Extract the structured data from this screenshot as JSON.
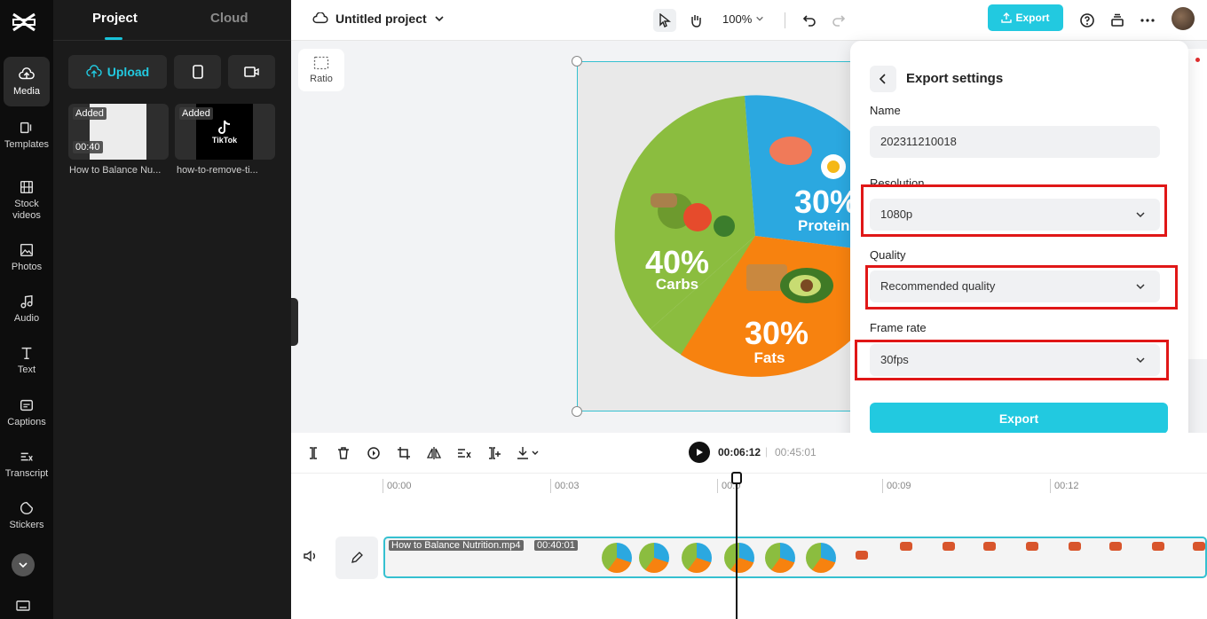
{
  "rail": {
    "items": [
      {
        "label": "Media"
      },
      {
        "label": "Templates"
      },
      {
        "label": "Stock videos"
      },
      {
        "label": "Photos"
      },
      {
        "label": "Audio"
      },
      {
        "label": "Text"
      },
      {
        "label": "Captions"
      },
      {
        "label": "Transcript"
      },
      {
        "label": "Stickers"
      }
    ]
  },
  "panel": {
    "tabs": [
      "Project",
      "Cloud"
    ],
    "upload_label": "Upload",
    "media": [
      {
        "badge": "Added",
        "duration": "00:40",
        "caption": "How to Balance Nu..."
      },
      {
        "badge": "Added",
        "caption": "how-to-remove-ti...",
        "logo_text": "TikTok"
      }
    ]
  },
  "topbar": {
    "project_name": "Untitled project",
    "zoom": "100%",
    "export_label": "Export"
  },
  "canvas": {
    "ratio_label": "Ratio",
    "pie": {
      "slices": [
        {
          "pct": "40%",
          "name": "Carbs",
          "color": "#8bbd3f"
        },
        {
          "pct": "30%",
          "name": "Proteins",
          "color": "#2ba8e0"
        },
        {
          "pct": "30%",
          "name": "Fats",
          "color": "#f7820f"
        }
      ]
    }
  },
  "export_settings": {
    "title": "Export settings",
    "name_label": "Name",
    "name_value": "202311210018",
    "resolution_label": "Resolution",
    "resolution_value": "1080p",
    "quality_label": "Quality",
    "quality_value": "Recommended quality",
    "framerate_label": "Frame rate",
    "framerate_value": "30fps",
    "export_button": "Export"
  },
  "timeline": {
    "current_time": "00:06:12",
    "total_time": "00:45:01",
    "ticks": [
      "00:00",
      "00:03",
      "00:0",
      "00:09",
      "00:12"
    ],
    "clip_name": "How to Balance Nutrition.mp4",
    "clip_duration": "00:40:01"
  },
  "colors": {
    "accent": "#22c9e0",
    "highlight": "#e01717"
  }
}
